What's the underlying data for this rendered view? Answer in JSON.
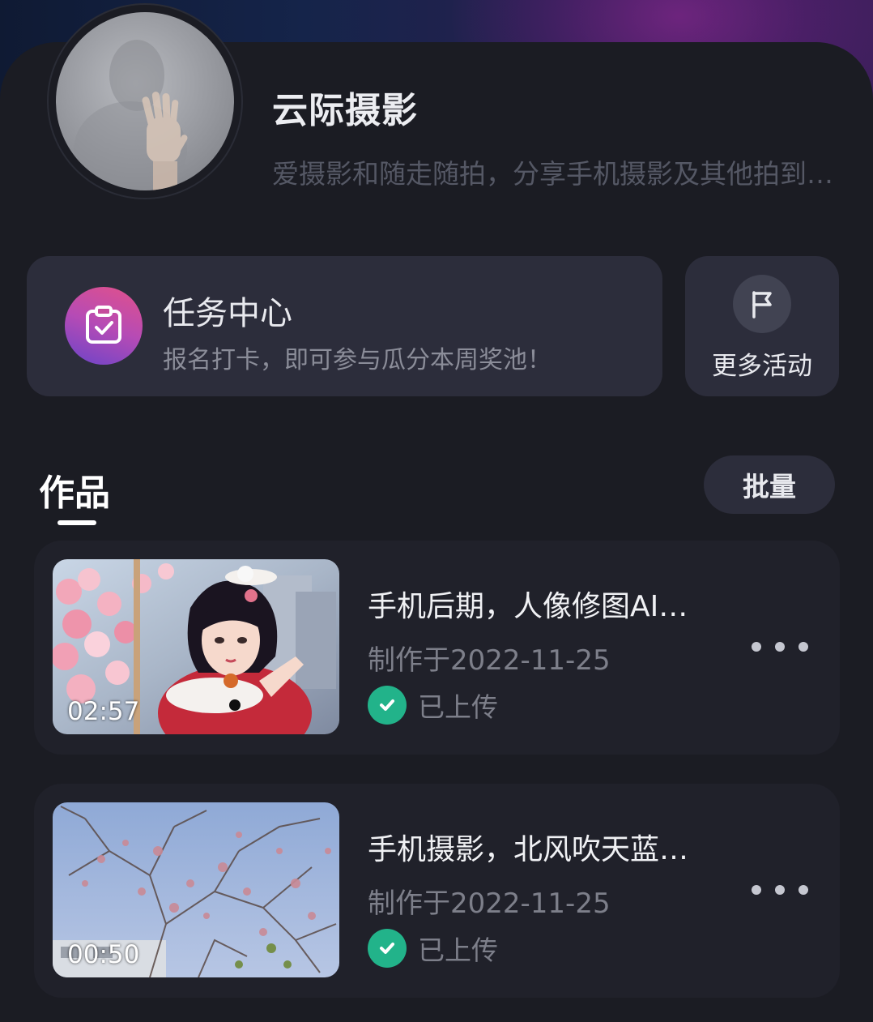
{
  "profile": {
    "name": "云际摄影",
    "bio": "爱摄影和随走随拍，分享手机摄影及其他拍到…"
  },
  "task_center": {
    "title": "任务中心",
    "subtitle": "报名打卡，即可参与瓜分本周奖池！",
    "icon": "calendar-check-icon"
  },
  "more_activities": {
    "label": "更多活动",
    "icon": "flag-icon"
  },
  "works": {
    "tab_label": "作品",
    "batch_label": "批量",
    "items": [
      {
        "title": "手机后期，人像修图AI…",
        "date": "制作于2022-11-25",
        "status": "已上传",
        "duration": "02:57"
      },
      {
        "title": "手机摄影，北风吹天蓝…",
        "date": "制作于2022-11-25",
        "status": "已上传",
        "duration": "00:50"
      }
    ]
  },
  "colors": {
    "background": "#15161c",
    "card": "#2c2d3b",
    "success": "#22b38a",
    "muted_text": "#7d7f8a"
  }
}
